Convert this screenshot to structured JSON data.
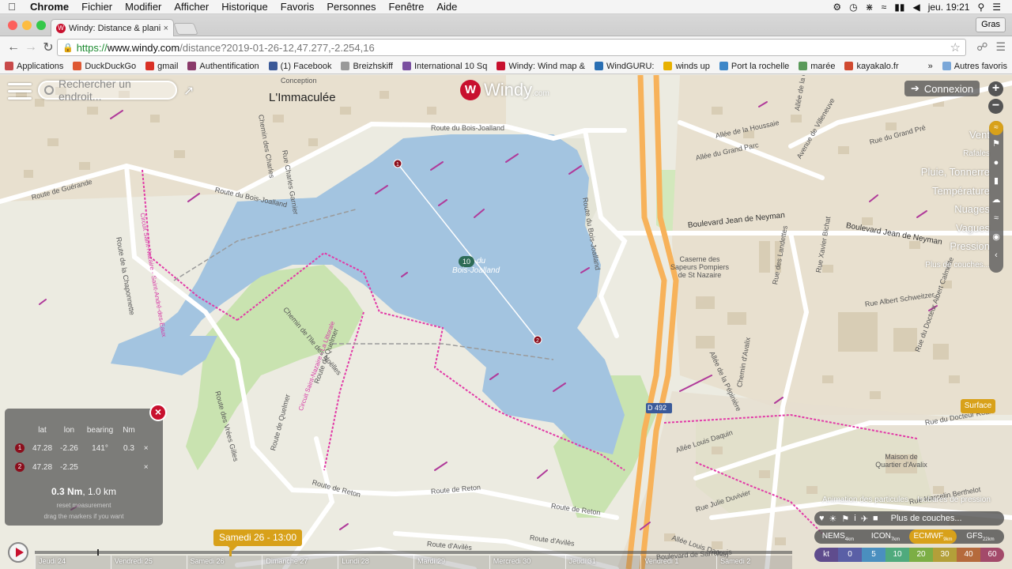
{
  "menubar": {
    "app": "Chrome",
    "items": [
      "Fichier",
      "Modifier",
      "Afficher",
      "Historique",
      "Favoris",
      "Personnes",
      "Fenêtre",
      "Aide"
    ],
    "clock": "jeu. 19:21"
  },
  "tab": {
    "title": "Windy: Distance & planific",
    "close": "×"
  },
  "gras": "Gras",
  "address": {
    "scheme": "https://",
    "host": "www.windy.com",
    "path": "/distance?2019-01-26-12,47.277,-2.254,16"
  },
  "bookmarks": [
    {
      "label": "Applications",
      "color": "#c84a4a"
    },
    {
      "label": "DuckDuckGo",
      "color": "#de5833"
    },
    {
      "label": "gmail",
      "color": "#d93025"
    },
    {
      "label": "Authentification",
      "color": "#8a3a6a"
    },
    {
      "label": "(1) Facebook",
      "color": "#3b5998"
    },
    {
      "label": "Breizhskiff",
      "color": "#999999"
    },
    {
      "label": "International 10 Sq",
      "color": "#7a4fa0"
    },
    {
      "label": "Windy: Wind map &",
      "color": "#c8102e"
    },
    {
      "label": "WindGURU:",
      "color": "#2a6fb3"
    },
    {
      "label": "winds up",
      "color": "#e8b100"
    },
    {
      "label": "Port la rochelle",
      "color": "#3d87c8"
    },
    {
      "label": "marée",
      "color": "#5a9a5a"
    },
    {
      "label": "kayakalo.fr",
      "color": "#d04a30"
    }
  ],
  "bookmarks_more": "»",
  "bookmarks_other": "Autres favoris",
  "search": {
    "placeholder": "Rechercher un endroit..."
  },
  "logo": {
    "name": "Windy",
    "suffix": ".com"
  },
  "connexion": "Connexion",
  "zoom": {
    "in": "+",
    "out": "−"
  },
  "layers": [
    "Vent",
    "Rafales",
    "Pluie, Tonnerre",
    "Température",
    "Nuages",
    "Vagues",
    "Pression",
    "Plus de couches..."
  ],
  "surface": "Surface",
  "map_labels": {
    "town": "L'Immaculée",
    "lake": "Étang du Bois-Joalland",
    "lake_short": "du",
    "lake_name": "Bois-Joalland",
    "wind_speed": "10",
    "route_bois_joalland": "Route du Bois-Joalland",
    "route_guerande": "Route de Guérande",
    "route_chaponnette": "Route de la Chaponnette",
    "route_reton": "Route de Reton",
    "route_aviles": "Route d'Avilès",
    "route_quelmer": "Route de Quelmer",
    "route_vrees": "Route des Vrées Gilles",
    "chemin_ile": "Chemin de l'Ile des Noëlles",
    "bd_neyman": "Boulevard Jean de Neyman",
    "rue_schweitzer": "Rue Albert Schweitzer",
    "rue_landettes": "Rue des Landettes",
    "chemin_avalix": "Chemin d'Avalix",
    "allee_pepiniere": "Allée de la Pépinière",
    "allee_daquin": "Allée Louis Daquin",
    "rue_duvivier": "Rue Julie Duvivier",
    "bd_sarrelouis": "Boulevard de Sarrelouis",
    "caserne": "Caserne des Sapeurs Pompiers de St Nazaire",
    "maison_quartier": "Maison de Quartier d'Avalix",
    "d492": "D 492",
    "rue_bertholot": "Rue Marcelin Berthelot",
    "rue_docteur_roux": "Rue du Docteur Roux",
    "allee_grand_parc": "Allée du Grand Parc",
    "allee_houssaie": "Allée de la Houssaie",
    "allee_carriere": "Allée de la Carrière",
    "av_villeneuve": "Avenue de Villeneuve",
    "rue_grand_pre": "Rue du Grand Pré",
    "rue_charles_garnier": "Rue Charles Garnier",
    "chemin_charles": "Chemin des Charles",
    "rue_xavier_bichat": "Rue Xavier Bichat",
    "rue_docteur_calmette": "Rue du Docteur Albert Calmette",
    "conception": "Conception",
    "cirpaux_1": "Circuit Saint-Nazaire - Saint-André-des-Eaux",
    "cirpaux_2": "Circuit Saint-Nazaire - La Littorale"
  },
  "measure": {
    "headers": [
      "lat",
      "lon",
      "bearing",
      "Nm"
    ],
    "rows": [
      {
        "n": "1",
        "lat": "47.28",
        "lon": "-2.26",
        "bearing": "141°",
        "nm": "0.3",
        "x": "×"
      },
      {
        "n": "2",
        "lat": "47.28",
        "lon": "-2.25",
        "bearing": "",
        "nm": "",
        "x": "×"
      }
    ],
    "total_nm": "0.3 Nm",
    "total_km": ", 1.0 km",
    "reset": "reset measurement",
    "drag": "drag the markers if you want",
    "close": "×"
  },
  "timeline": {
    "current": "Samedi 26 - 13:00",
    "days": [
      "Jeudi 24",
      "Vendredi 25",
      "Samedi 26",
      "Dimanche 27",
      "Lundi 28",
      "Mardi 29",
      "Mercredi 30",
      "Jeudi 31",
      "Vendredi 1",
      "Samedi 2"
    ],
    "progress": 0.257
  },
  "bottom_right": {
    "hint_left": "Animation des particules",
    "hint_right": "Isobares de pression",
    "more_layers": "Plus de couches...",
    "models": [
      {
        "name": "NEMS",
        "res": "4km",
        "active": false
      },
      {
        "name": "ICON",
        "res": "7km",
        "active": false
      },
      {
        "name": "ECMWF",
        "res": "9km",
        "active": true
      },
      {
        "name": "GFS",
        "res": "22km",
        "active": false
      }
    ],
    "scale": [
      {
        "v": "kt",
        "c": "#5f4c8d"
      },
      {
        "v": "0",
        "c": "#5a5fa6"
      },
      {
        "v": "5",
        "c": "#4a8fbf"
      },
      {
        "v": "10",
        "c": "#4faa7d"
      },
      {
        "v": "20",
        "c": "#7cae45"
      },
      {
        "v": "30",
        "c": "#b39f39"
      },
      {
        "v": "40",
        "c": "#b56a3c"
      },
      {
        "v": "60",
        "c": "#a34a6a"
      }
    ]
  },
  "colors": {
    "windy_red": "#c8102e",
    "accent": "#d8a11a",
    "water": "#a3c4e0",
    "green": "#bfe0a8",
    "pink_trail": "#e23aa7"
  }
}
